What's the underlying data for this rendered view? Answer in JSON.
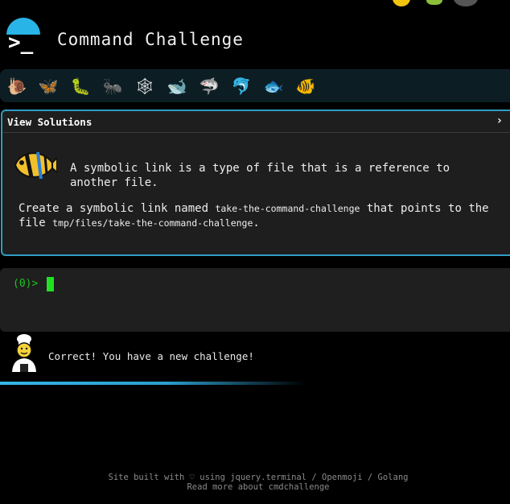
{
  "app": {
    "title": "Command Challenge",
    "logo_glyph": ">_",
    "accent_color": "#28b4e6"
  },
  "top_icons": [
    "terminal-icon",
    "trophy-icon",
    "bug-icon",
    "avatar-icon"
  ],
  "levels": [
    {
      "icon": "snail-icon",
      "glyph": "🐌"
    },
    {
      "icon": "butterfly-icon",
      "glyph": "🦋"
    },
    {
      "icon": "caterpillar-icon",
      "glyph": "🐛"
    },
    {
      "icon": "ant-icon",
      "glyph": "🐜"
    },
    {
      "icon": "spider-web-icon",
      "glyph": "🕸"
    },
    {
      "icon": "whale-icon",
      "glyph": "🐋"
    },
    {
      "icon": "shark-icon",
      "glyph": "🦈"
    },
    {
      "icon": "dolphin-icon",
      "glyph": "🐬"
    },
    {
      "icon": "fish-icon",
      "glyph": "🐟"
    },
    {
      "icon": "tropical-fish-icon",
      "glyph": "🐠"
    }
  ],
  "panel": {
    "title": "View Solutions",
    "chevron": "›",
    "description": "A symbolic link is a type of file that is a reference to another file.",
    "task_prefix": "Create a symbolic link named ",
    "task_name": "take-the-command-challenge",
    "task_middle": " that points to the file ",
    "task_path": "tmp/files/take-the-command-challenge",
    "task_suffix": "."
  },
  "terminal": {
    "prompt": "(0)>"
  },
  "feedback": {
    "message": "Correct! You have a new challenge!"
  },
  "footer": {
    "line1": "Site built with ♡ using jquery.terminal / Openmoji / Golang",
    "line2": "Read more about cmdchallenge"
  }
}
